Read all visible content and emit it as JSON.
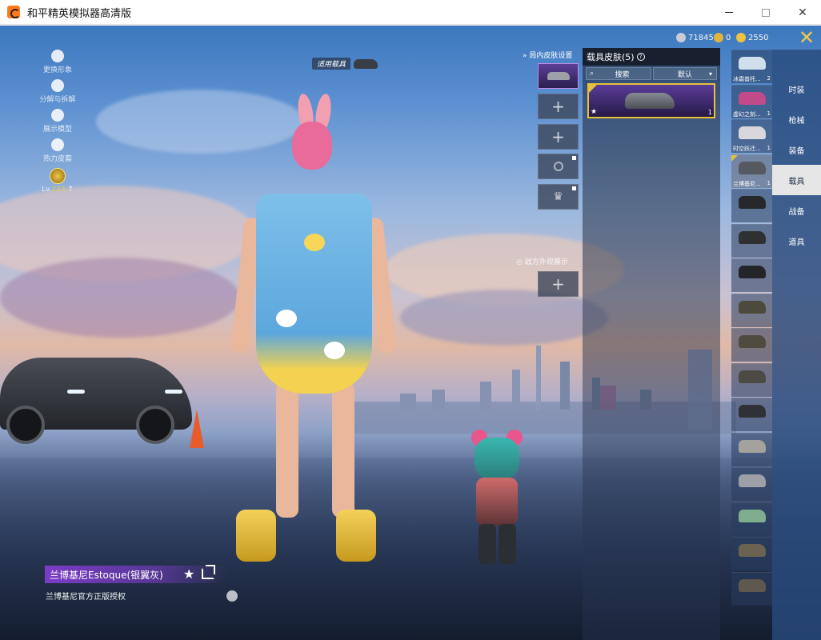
{
  "window": {
    "title": "和平精英模拟器高清版",
    "minimize": "",
    "maximize": "",
    "close": "✕"
  },
  "currency": [
    {
      "icon": "silver-coin-icon",
      "value": "71845",
      "color": "#c9ccd2"
    },
    {
      "icon": "gold-token-icon",
      "value": "0",
      "color": "#e0b63a"
    },
    {
      "icon": "shield-coin-icon",
      "value": "2550",
      "color": "#f0c341"
    }
  ],
  "left_tools": [
    {
      "icon": "person-icon",
      "label": "更换形象"
    },
    {
      "icon": "puzzle-icon",
      "label": "分解与拆解"
    },
    {
      "icon": "eye-icon",
      "label": "展示模型"
    },
    {
      "icon": "fire-icon",
      "label": "热力皮套"
    }
  ],
  "level": {
    "value": "223",
    "prefix": "Lv."
  },
  "applied_vehicle_label": "适用载具",
  "skin_settings_title": "局内皮肤设置",
  "slot_section2_title": "敌方外观展示",
  "skin_panel": {
    "title": "载具皮肤(5)",
    "help": "?",
    "search_label": "搜索",
    "sort_label": "默认",
    "selected_count": "1"
  },
  "vehicles": [
    {
      "name": "冰霜兽托...",
      "count": "2",
      "color": "#cfe0ec"
    },
    {
      "name": "虚幻之刻...",
      "count": "1",
      "color": "#c04a8a"
    },
    {
      "name": "时空跃迁...",
      "count": "1",
      "color": "#d8d8dc"
    },
    {
      "name": "兰博基尼...",
      "count": "1",
      "color": "#555960",
      "selected": true
    },
    {
      "name": "",
      "count": "",
      "color": "#26282c"
    },
    {
      "name": "",
      "count": "",
      "color": "#2e3032"
    },
    {
      "name": "",
      "count": "",
      "color": "#242528"
    },
    {
      "name": "",
      "count": "",
      "color": "#4c4a3c"
    },
    {
      "name": "",
      "count": "",
      "color": "#4f4b3e"
    },
    {
      "name": "",
      "count": "",
      "color": "#4b4b44"
    },
    {
      "name": "",
      "count": "",
      "color": "#2f3136"
    },
    {
      "name": "",
      "count": "",
      "color": "#a4a29c"
    },
    {
      "name": "",
      "count": "",
      "color": "#9da0a6"
    },
    {
      "name": "",
      "count": "",
      "color": "#7fae8f"
    },
    {
      "name": "",
      "count": "",
      "color": "#6b6252"
    },
    {
      "name": "",
      "count": "",
      "color": "#5e584e"
    }
  ],
  "categories": [
    "时装",
    "枪械",
    "装备",
    "载具",
    "战备",
    "道具"
  ],
  "active_category": "载具",
  "skin_name": "兰博基尼Estoque(银翼灰)",
  "license_text": "兰博基尼官方正版授权"
}
